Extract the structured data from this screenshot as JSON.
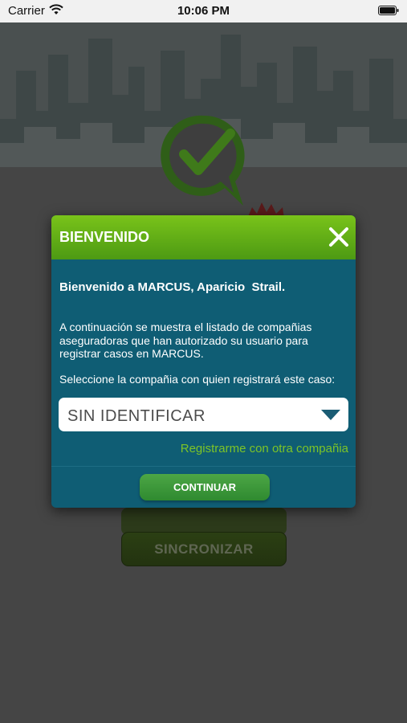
{
  "status_bar": {
    "carrier": "Carrier",
    "time": "10:06 PM"
  },
  "background": {
    "sync_button_label": "SINCRONIZAR"
  },
  "dialog": {
    "title": "BIENVENIDO",
    "welcome": "Bienvenido a MARCUS, Aparicio  Strail.",
    "intro": "A continuación se muestra el listado de compañias aseguradoras que han autorizado su usuario para registrar casos en MARCUS.",
    "prompt": "Seleccione la compañia con quien registrará este caso:",
    "select_value": "SIN IDENTIFICAR",
    "other_company_link": "Registrarme con otra compañia",
    "continue_label": "CONTINUAR"
  },
  "colors": {
    "header_green": "#79c31a",
    "dialog_teal": "#0f5d74",
    "link_green": "#7dc427",
    "button_green": "#4ca645"
  },
  "icons": [
    "wifi-icon",
    "battery-icon",
    "close-icon",
    "chevron-down-icon",
    "check-logo-icon"
  ]
}
